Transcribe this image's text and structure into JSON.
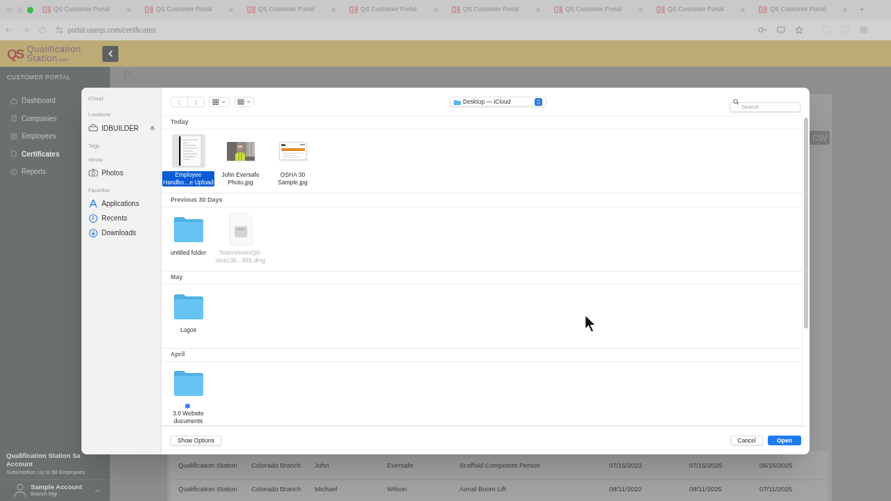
{
  "browser": {
    "tabs": [
      {
        "title": "QS Customer Portal"
      },
      {
        "title": "QS Customer Portal"
      },
      {
        "title": "QS Customer Portal"
      },
      {
        "title": "QS Customer Portal"
      },
      {
        "title": "QS Customer Portal"
      },
      {
        "title": "QS Customer Portal"
      },
      {
        "title": "QS Customer Portal"
      },
      {
        "title": "QS Customer Portal"
      }
    ],
    "new_tab": "+",
    "url": "portal.useqs.com/certificates"
  },
  "app_header": {
    "logo": {
      "mark": "QS",
      "line1": "Qualification",
      "line2": "Station",
      "suffix": ".com"
    }
  },
  "sidebar": {
    "heading": "CUSTOMER PORTAL",
    "items": [
      {
        "label": "Dashboard",
        "selected": false
      },
      {
        "label": "Companies",
        "selected": false
      },
      {
        "label": "Employees",
        "selected": false
      },
      {
        "label": "Certificates",
        "selected": true
      },
      {
        "label": "Reports",
        "selected": false
      }
    ],
    "account": {
      "org_line1": "Qualification Station Sa",
      "org_line2": "Account",
      "subscription": "Subscription: Up to 50 Employees",
      "user": "Sample Account",
      "role": "Branch Mgr"
    }
  },
  "main": {
    "export_button": "CSV",
    "rows": [
      {
        "cells": [
          "Qualification Station",
          "Colorado Branch",
          "John",
          "Eversafe",
          "Scaffold Competent Person",
          "07/15/2022",
          "07/15/2025",
          "06/15/2025"
        ]
      },
      {
        "cells": [
          "Qualification Station",
          "Colorado Branch",
          "Michael",
          "Wilson",
          "Aerial Boom Lift",
          "08/11/2022",
          "08/11/2025",
          "07/11/2025"
        ]
      }
    ]
  },
  "dialog": {
    "sidebar": {
      "sections": [
        {
          "heading": "iCloud"
        },
        {
          "heading": "Locations",
          "items": [
            {
              "label": "IDBUILDER",
              "ejectable": true
            }
          ]
        },
        {
          "heading": "Tags"
        },
        {
          "heading": "Media",
          "items": [
            {
              "label": "Photos",
              "ejectable": false
            }
          ]
        },
        {
          "heading": "Favorites",
          "items": [
            {
              "label": "Applications",
              "ejectable": false
            },
            {
              "label": "Recents",
              "ejectable": false
            },
            {
              "label": "Downloads",
              "ejectable": false
            }
          ]
        }
      ]
    },
    "location": "Desktop — iCloud",
    "search_placeholder": "Search",
    "groups": [
      {
        "heading": "Today",
        "items": [
          {
            "kind": "document",
            "name": "Employee Handbo…e Upload",
            "selected": true,
            "disabled": false
          },
          {
            "name": "John Eversafe Photo.jpg",
            "selected": false,
            "disabled": false
          },
          {
            "kind": "certificate",
            "name": "OSHA 30 Sample.jpg",
            "selected": false,
            "disabled": false
          }
        ]
      },
      {
        "heading": "Previous 30 Days",
        "items": [
          {
            "kind": "folder",
            "name": "untitled folder",
            "selected": false,
            "disabled": false
          },
          {
            "kind": "disk-image",
            "name": "TeamViewerQS-idos138…965.dmg",
            "selected": false,
            "disabled": true
          }
        ]
      },
      {
        "heading": "May",
        "items": [
          {
            "kind": "folder",
            "name": "Logos",
            "selected": false,
            "disabled": false
          }
        ]
      },
      {
        "heading": "April",
        "items": [
          {
            "kind": "folder",
            "name": "3.0 Website documents",
            "selected": false,
            "disabled": false,
            "color": "#3b82f6"
          }
        ]
      }
    ],
    "show_options": "Show Options",
    "cancel": "Cancel",
    "open": "Open"
  }
}
